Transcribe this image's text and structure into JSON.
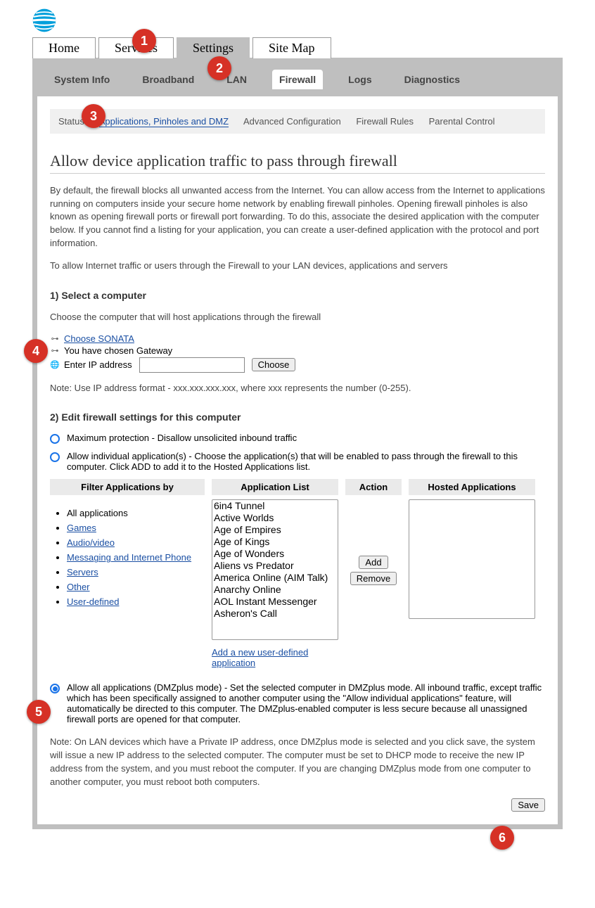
{
  "main_tabs": {
    "home": "Home",
    "services": "Services",
    "settings": "Settings",
    "site_map": "Site Map"
  },
  "sub_tabs": {
    "system_info": "System Info",
    "broadband": "Broadband",
    "lan": "LAN",
    "firewall": "Firewall",
    "logs": "Logs",
    "diagnostics": "Diagnostics"
  },
  "tertiary": {
    "status": "Status",
    "apps": "Applications, Pinholes and DMZ",
    "advanced": "Advanced Configuration",
    "rules": "Firewall Rules",
    "parental": "Parental Control"
  },
  "title": "Allow device application traffic to pass through firewall",
  "intro1": "By default, the firewall blocks all unwanted access from the Internet. You can allow access from the Internet to applications running on computers inside your secure home network by enabling firewall pinholes. Opening firewall pinholes is also known as opening firewall ports or firewall port forwarding. To do this, associate the desired application with the computer below. If you cannot find a listing for your application, you can create a user-defined application with the protocol and port information.",
  "intro2": "To allow Internet traffic or users through the Firewall to your LAN devices, applications and servers",
  "step1_title": "1) Select a computer",
  "step1_desc": "Choose the computer that will host applications through the firewall",
  "choose_sonata": "Choose SONATA",
  "chosen_gateway": "You have chosen Gateway",
  "enter_ip_label": "Enter IP address",
  "choose_btn": "Choose",
  "ip_note": "Note: Use IP address format - xxx.xxx.xxx.xxx, where xxx represents the number (0-255).",
  "step2_title": "2) Edit firewall settings for this computer",
  "opt_max": "Maximum protection - Disallow unsolicited inbound traffic",
  "opt_allow_ind": "Allow individual application(s) - Choose the application(s) that will be enabled to pass through the firewall to this computer. Click ADD to add it to the Hosted Applications list.",
  "col_filter": "Filter Applications by",
  "col_app_list": "Application List",
  "col_action": "Action",
  "col_hosted": "Hosted Applications",
  "filters": {
    "all": "All applications",
    "games": "Games",
    "av": "Audio/video",
    "msg": "Messaging and Internet Phone",
    "servers": "Servers",
    "other": "Other",
    "user": "User-defined"
  },
  "apps": [
    "6in4 Tunnel",
    "Active Worlds",
    "Age of Empires",
    "Age of Kings",
    "Age of Wonders",
    "Aliens vs Predator",
    "America Online (AIM Talk)",
    "Anarchy Online",
    "AOL Instant Messenger",
    "Asheron's Call"
  ],
  "add_btn": "Add",
  "remove_btn": "Remove",
  "add_user_link": "Add a new user-defined application",
  "opt_dmz": "Allow all applications (DMZplus mode) - Set the selected computer in DMZplus mode. All inbound traffic, except traffic which has been specifically assigned to another computer using the \"Allow individual applications\" feature, will automatically be directed to this computer. The DMZplus-enabled computer is less secure because all unassigned firewall ports are opened for that computer.",
  "dmz_note": "Note: On LAN devices which have a Private IP address, once DMZplus mode is selected and you click save, the system will issue a new IP address to the selected computer. The computer must be set to DHCP mode to receive the new IP address from the system, and you must reboot the computer. If you are changing DMZplus mode from one computer to another computer, you must reboot both computers.",
  "save_btn": "Save",
  "markers": [
    "1",
    "2",
    "3",
    "4",
    "5",
    "6"
  ]
}
